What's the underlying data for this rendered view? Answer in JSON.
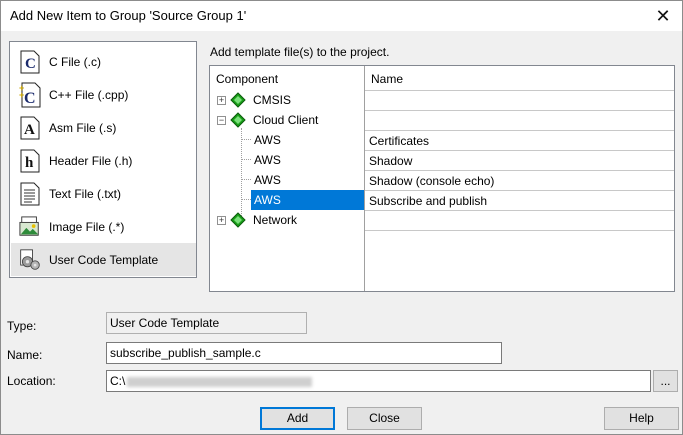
{
  "window": {
    "title": "Add New Item to Group 'Source Group 1'"
  },
  "types": [
    {
      "label": "C File (.c)",
      "icon": "c-file-icon",
      "glyph": "C"
    },
    {
      "label": "C++ File (.cpp)",
      "icon": "cpp-file-icon",
      "glyph": "C"
    },
    {
      "label": "Asm File (.s)",
      "icon": "asm-file-icon",
      "glyph": "A"
    },
    {
      "label": "Header File (.h)",
      "icon": "header-file-icon",
      "glyph": "h"
    },
    {
      "label": "Text File (.txt)",
      "icon": "text-file-icon",
      "glyph": ""
    },
    {
      "label": "Image File (.*)",
      "icon": "image-file-icon",
      "glyph": ""
    },
    {
      "label": "User Code Template",
      "icon": "user-code-template-icon",
      "glyph": ""
    }
  ],
  "hint": "Add template file(s) to the project.",
  "tree": {
    "header_component": "Component",
    "header_name": "Name",
    "nodes": [
      {
        "label": "CMSIS",
        "expander": "+"
      },
      {
        "label": "Cloud Client",
        "expander": "−"
      },
      {
        "label": "AWS",
        "name": "Certificates"
      },
      {
        "label": "AWS",
        "name": "Shadow"
      },
      {
        "label": "AWS",
        "name": "Shadow (console echo)"
      },
      {
        "label": "AWS",
        "name": "Subscribe and publish"
      },
      {
        "label": "Network",
        "expander": "+"
      }
    ]
  },
  "form": {
    "type_label": "Type:",
    "type_value": "User Code Template",
    "name_label": "Name:",
    "name_value": "subscribe_publish_sample.c",
    "location_label": "Location:",
    "location_value": "C:\\",
    "browse_label": "..."
  },
  "buttons": {
    "add": "Add",
    "close": "Close",
    "help": "Help"
  },
  "colors": {
    "selection": "#0078d7",
    "component_icon": "#1aa01a"
  }
}
